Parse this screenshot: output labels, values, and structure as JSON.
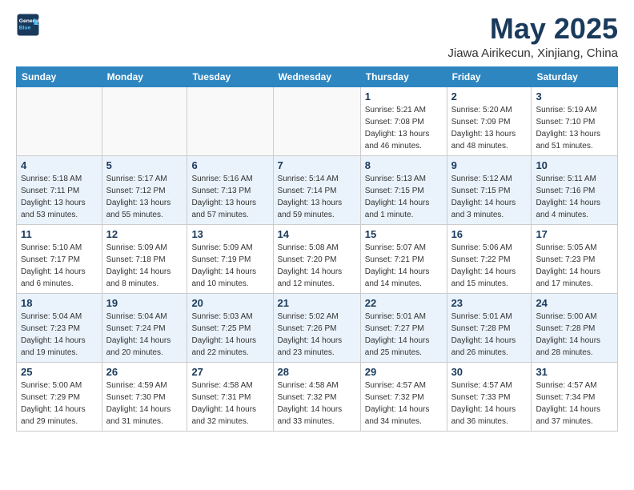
{
  "logo": {
    "line1": "General",
    "line2": "Blue"
  },
  "title": "May 2025",
  "location": "Jiawa Airikecun, Xinjiang, China",
  "days_of_week": [
    "Sunday",
    "Monday",
    "Tuesday",
    "Wednesday",
    "Thursday",
    "Friday",
    "Saturday"
  ],
  "weeks": [
    [
      {
        "num": "",
        "info": ""
      },
      {
        "num": "",
        "info": ""
      },
      {
        "num": "",
        "info": ""
      },
      {
        "num": "",
        "info": ""
      },
      {
        "num": "1",
        "info": "Sunrise: 5:21 AM\nSunset: 7:08 PM\nDaylight: 13 hours\nand 46 minutes."
      },
      {
        "num": "2",
        "info": "Sunrise: 5:20 AM\nSunset: 7:09 PM\nDaylight: 13 hours\nand 48 minutes."
      },
      {
        "num": "3",
        "info": "Sunrise: 5:19 AM\nSunset: 7:10 PM\nDaylight: 13 hours\nand 51 minutes."
      }
    ],
    [
      {
        "num": "4",
        "info": "Sunrise: 5:18 AM\nSunset: 7:11 PM\nDaylight: 13 hours\nand 53 minutes."
      },
      {
        "num": "5",
        "info": "Sunrise: 5:17 AM\nSunset: 7:12 PM\nDaylight: 13 hours\nand 55 minutes."
      },
      {
        "num": "6",
        "info": "Sunrise: 5:16 AM\nSunset: 7:13 PM\nDaylight: 13 hours\nand 57 minutes."
      },
      {
        "num": "7",
        "info": "Sunrise: 5:14 AM\nSunset: 7:14 PM\nDaylight: 13 hours\nand 59 minutes."
      },
      {
        "num": "8",
        "info": "Sunrise: 5:13 AM\nSunset: 7:15 PM\nDaylight: 14 hours\nand 1 minute."
      },
      {
        "num": "9",
        "info": "Sunrise: 5:12 AM\nSunset: 7:15 PM\nDaylight: 14 hours\nand 3 minutes."
      },
      {
        "num": "10",
        "info": "Sunrise: 5:11 AM\nSunset: 7:16 PM\nDaylight: 14 hours\nand 4 minutes."
      }
    ],
    [
      {
        "num": "11",
        "info": "Sunrise: 5:10 AM\nSunset: 7:17 PM\nDaylight: 14 hours\nand 6 minutes."
      },
      {
        "num": "12",
        "info": "Sunrise: 5:09 AM\nSunset: 7:18 PM\nDaylight: 14 hours\nand 8 minutes."
      },
      {
        "num": "13",
        "info": "Sunrise: 5:09 AM\nSunset: 7:19 PM\nDaylight: 14 hours\nand 10 minutes."
      },
      {
        "num": "14",
        "info": "Sunrise: 5:08 AM\nSunset: 7:20 PM\nDaylight: 14 hours\nand 12 minutes."
      },
      {
        "num": "15",
        "info": "Sunrise: 5:07 AM\nSunset: 7:21 PM\nDaylight: 14 hours\nand 14 minutes."
      },
      {
        "num": "16",
        "info": "Sunrise: 5:06 AM\nSunset: 7:22 PM\nDaylight: 14 hours\nand 15 minutes."
      },
      {
        "num": "17",
        "info": "Sunrise: 5:05 AM\nSunset: 7:23 PM\nDaylight: 14 hours\nand 17 minutes."
      }
    ],
    [
      {
        "num": "18",
        "info": "Sunrise: 5:04 AM\nSunset: 7:23 PM\nDaylight: 14 hours\nand 19 minutes."
      },
      {
        "num": "19",
        "info": "Sunrise: 5:04 AM\nSunset: 7:24 PM\nDaylight: 14 hours\nand 20 minutes."
      },
      {
        "num": "20",
        "info": "Sunrise: 5:03 AM\nSunset: 7:25 PM\nDaylight: 14 hours\nand 22 minutes."
      },
      {
        "num": "21",
        "info": "Sunrise: 5:02 AM\nSunset: 7:26 PM\nDaylight: 14 hours\nand 23 minutes."
      },
      {
        "num": "22",
        "info": "Sunrise: 5:01 AM\nSunset: 7:27 PM\nDaylight: 14 hours\nand 25 minutes."
      },
      {
        "num": "23",
        "info": "Sunrise: 5:01 AM\nSunset: 7:28 PM\nDaylight: 14 hours\nand 26 minutes."
      },
      {
        "num": "24",
        "info": "Sunrise: 5:00 AM\nSunset: 7:28 PM\nDaylight: 14 hours\nand 28 minutes."
      }
    ],
    [
      {
        "num": "25",
        "info": "Sunrise: 5:00 AM\nSunset: 7:29 PM\nDaylight: 14 hours\nand 29 minutes."
      },
      {
        "num": "26",
        "info": "Sunrise: 4:59 AM\nSunset: 7:30 PM\nDaylight: 14 hours\nand 31 minutes."
      },
      {
        "num": "27",
        "info": "Sunrise: 4:58 AM\nSunset: 7:31 PM\nDaylight: 14 hours\nand 32 minutes."
      },
      {
        "num": "28",
        "info": "Sunrise: 4:58 AM\nSunset: 7:32 PM\nDaylight: 14 hours\nand 33 minutes."
      },
      {
        "num": "29",
        "info": "Sunrise: 4:57 AM\nSunset: 7:32 PM\nDaylight: 14 hours\nand 34 minutes."
      },
      {
        "num": "30",
        "info": "Sunrise: 4:57 AM\nSunset: 7:33 PM\nDaylight: 14 hours\nand 36 minutes."
      },
      {
        "num": "31",
        "info": "Sunrise: 4:57 AM\nSunset: 7:34 PM\nDaylight: 14 hours\nand 37 minutes."
      }
    ]
  ]
}
